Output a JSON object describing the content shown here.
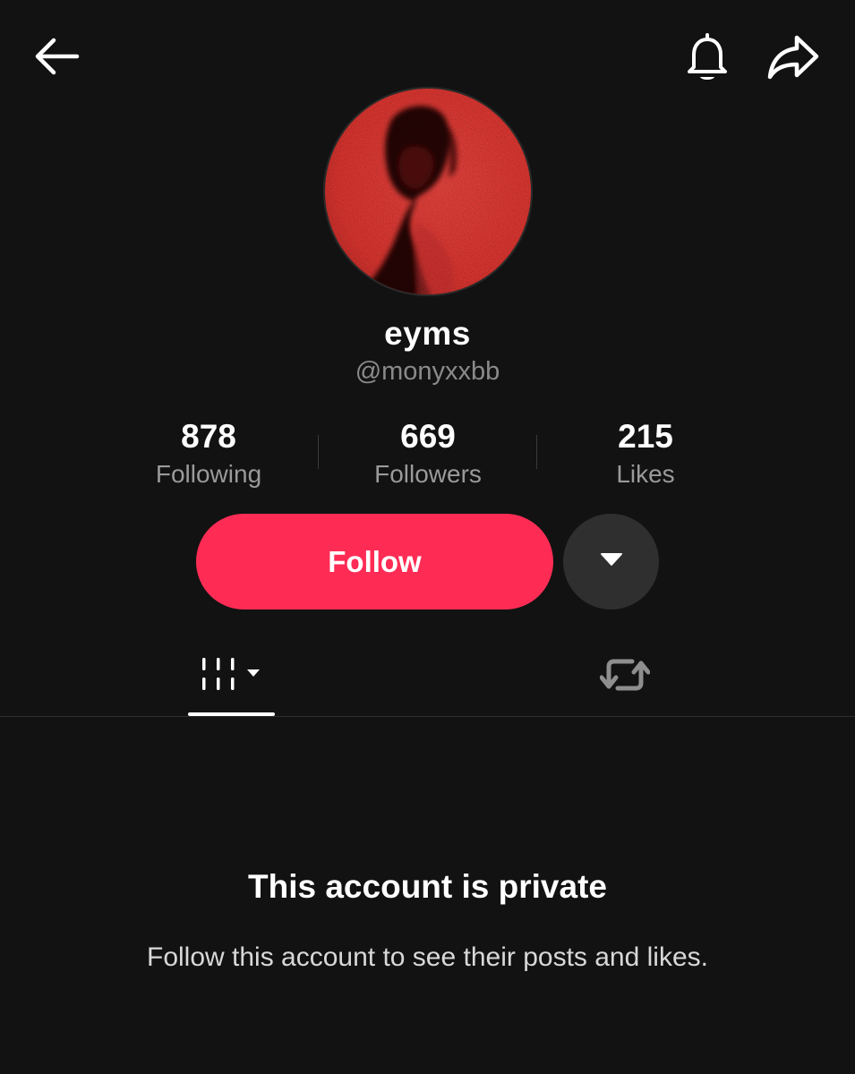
{
  "header": {
    "back_icon": "arrow-left-icon",
    "bell_icon": "bell-icon",
    "share_icon": "share-arrow-icon"
  },
  "profile": {
    "display_name": "eyms",
    "username": "@monyxxbb",
    "avatar_color": "#ff3b3b"
  },
  "stats": [
    {
      "value": "878",
      "label": "Following"
    },
    {
      "value": "669",
      "label": "Followers"
    },
    {
      "value": "215",
      "label": "Likes"
    }
  ],
  "actions": {
    "follow_label": "Follow",
    "follow_color": "#fe2c55",
    "more_icon": "caret-down-icon"
  },
  "tabs": [
    {
      "icon": "videos-grid-icon",
      "selected": true
    },
    {
      "icon": "repost-icon",
      "selected": false
    }
  ],
  "private_notice": {
    "title": "This account is private",
    "message": "Follow this account to see their posts and likes."
  }
}
